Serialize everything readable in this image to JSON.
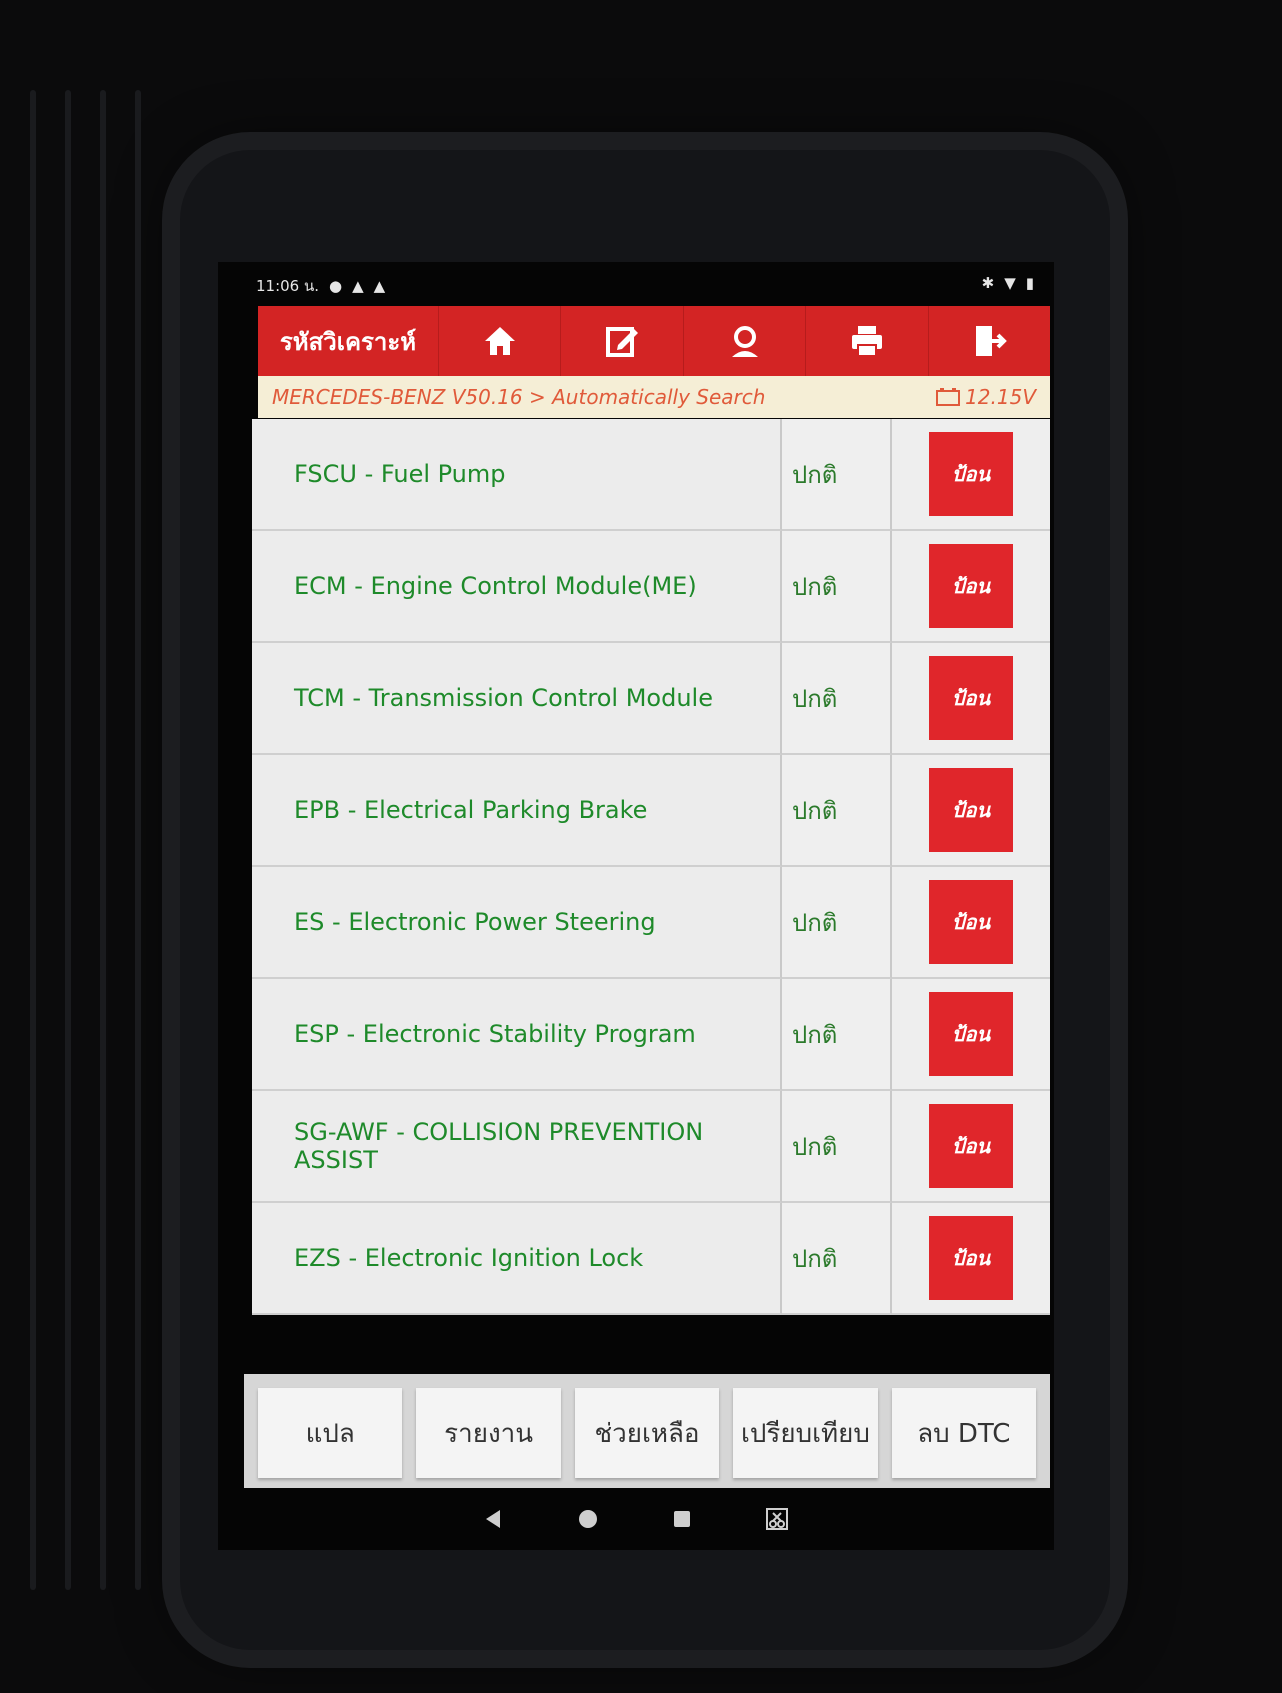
{
  "status_bar": {
    "time": "11:06 น."
  },
  "toolbar": {
    "title": "รหัสวิเคราะห์"
  },
  "breadcrumb": {
    "path": "MERCEDES-BENZ V50.16 > Automatically Search",
    "voltage": "12.15V"
  },
  "modules": [
    {
      "name": "FSCU - Fuel Pump",
      "status": "ปกติ",
      "action": "ป้อน"
    },
    {
      "name": "ECM - Engine Control Module(ME)",
      "status": "ปกติ",
      "action": "ป้อน"
    },
    {
      "name": "TCM - Transmission Control Module",
      "status": "ปกติ",
      "action": "ป้อน"
    },
    {
      "name": "EPB - Electrical Parking Brake",
      "status": "ปกติ",
      "action": "ป้อน"
    },
    {
      "name": "ES - Electronic Power Steering",
      "status": "ปกติ",
      "action": "ป้อน"
    },
    {
      "name": "ESP - Electronic Stability Program",
      "status": "ปกติ",
      "action": "ป้อน"
    },
    {
      "name": "SG-AWF - COLLISION PREVENTION ASSIST",
      "status": "ปกติ",
      "action": "ป้อน"
    },
    {
      "name": "EZS - Electronic Ignition Lock",
      "status": "ปกติ",
      "action": "ป้อน"
    }
  ],
  "bottom_buttons": {
    "translate": "แปล",
    "report": "รายงาน",
    "help": "ช่วยเหลือ",
    "compare": "เปรียบเทียบ",
    "clear_dtc": "ลบ DTC"
  },
  "colors": {
    "toolbar": "#d32424",
    "action_button": "#e0262b",
    "module_text": "#1e8a2a",
    "breadcrumb_text": "#e05a3a"
  },
  "icons": [
    "home-icon",
    "edit-icon",
    "support-icon",
    "print-icon",
    "exit-icon"
  ]
}
